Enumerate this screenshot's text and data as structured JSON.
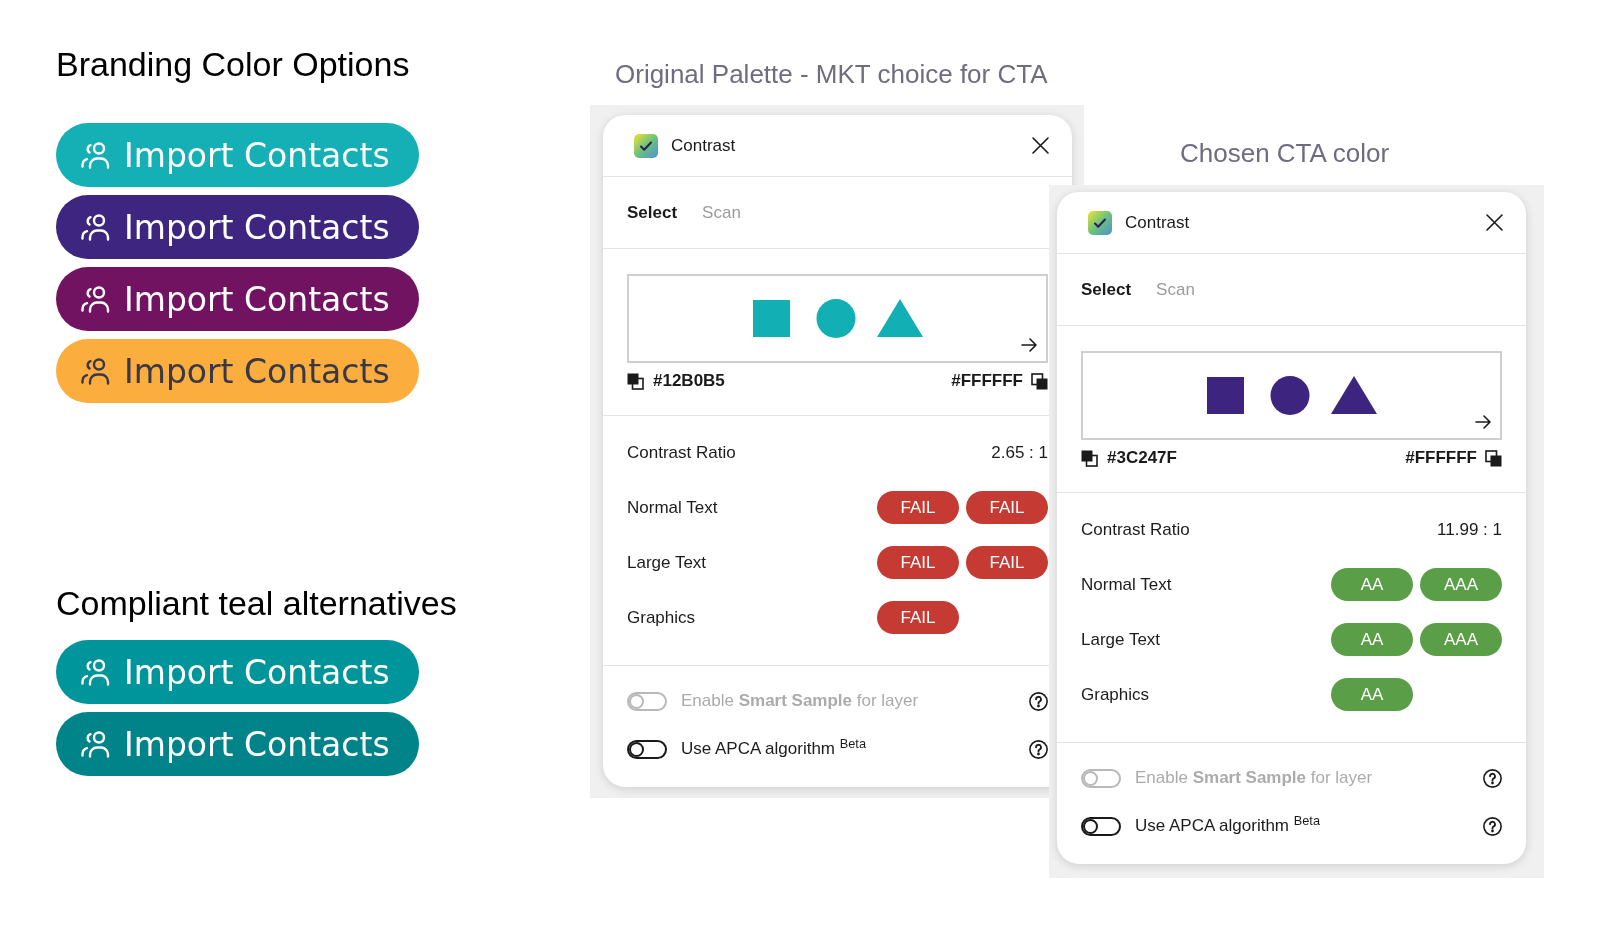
{
  "sections": [
    {
      "heading": "Branding Color Options",
      "buttons": [
        {
          "label": "Import Contacts",
          "color": "#14b0b5"
        },
        {
          "label": "Import Contacts",
          "color": "#3d2580"
        },
        {
          "label": "Import Contacts",
          "color": "#721361"
        },
        {
          "label": "Import Contacts",
          "color": "#fbad3d"
        }
      ]
    },
    {
      "heading": "Compliant teal alternatives",
      "buttons": [
        {
          "label": "Import Contacts",
          "color": "#00959a"
        },
        {
          "label": "Import Contacts",
          "color": "#00848a"
        }
      ]
    }
  ],
  "panels": [
    {
      "caption": "Original Palette - MKT choice for CTA",
      "title": "Contrast",
      "tabs": [
        {
          "label": "Select",
          "selected": true
        },
        {
          "label": "Scan",
          "selected": false
        }
      ],
      "preview": {
        "color": "#12b0b5",
        "foreground": "#12B0B5",
        "background": "#FFFFFF"
      },
      "contrast_ratio": {
        "label": "Contrast Ratio",
        "value": "2.65 : 1"
      },
      "checks": [
        {
          "label": "Normal Text",
          "results": [
            {
              "label": "FAIL",
              "pass": false
            },
            {
              "label": "FAIL",
              "pass": false
            }
          ]
        },
        {
          "label": "Large Text",
          "results": [
            {
              "label": "FAIL",
              "pass": false
            },
            {
              "label": "FAIL",
              "pass": false
            }
          ]
        },
        {
          "label": "Graphics",
          "results": [
            {
              "label": "FAIL",
              "pass": false
            }
          ]
        }
      ],
      "toggles": [
        {
          "label": "Enable **Smart Sample** for layer",
          "on": false,
          "disabled": true
        },
        {
          "label": "Use APCA algorithm $^{Beta}$",
          "on": false,
          "disabled": false
        }
      ]
    },
    {
      "caption": "Chosen CTA color",
      "title": "Contrast",
      "tabs": [
        {
          "label": "Select",
          "selected": true
        },
        {
          "label": "Scan",
          "selected": false
        }
      ],
      "preview": {
        "color": "#3c247f",
        "foreground": "#3C247F",
        "background": "#FFFFFF"
      },
      "contrast_ratio": {
        "label": "Contrast Ratio",
        "value": "11.99 : 1"
      },
      "checks": [
        {
          "label": "Normal Text",
          "results": [
            {
              "label": "AA",
              "pass": true
            },
            {
              "label": "AAA",
              "pass": true
            }
          ]
        },
        {
          "label": "Large Text",
          "results": [
            {
              "label": "AA",
              "pass": true
            },
            {
              "label": "AAA",
              "pass": true
            }
          ]
        },
        {
          "label": "Graphics",
          "results": [
            {
              "label": "AA",
              "pass": true
            }
          ]
        }
      ],
      "toggles": [
        {
          "label": "Enable **Smart Sample** for layer",
          "on": false,
          "disabled": true
        },
        {
          "label": "Use APCA algorithm $^{Beta}$",
          "on": false,
          "disabled": false
        }
      ]
    }
  ]
}
